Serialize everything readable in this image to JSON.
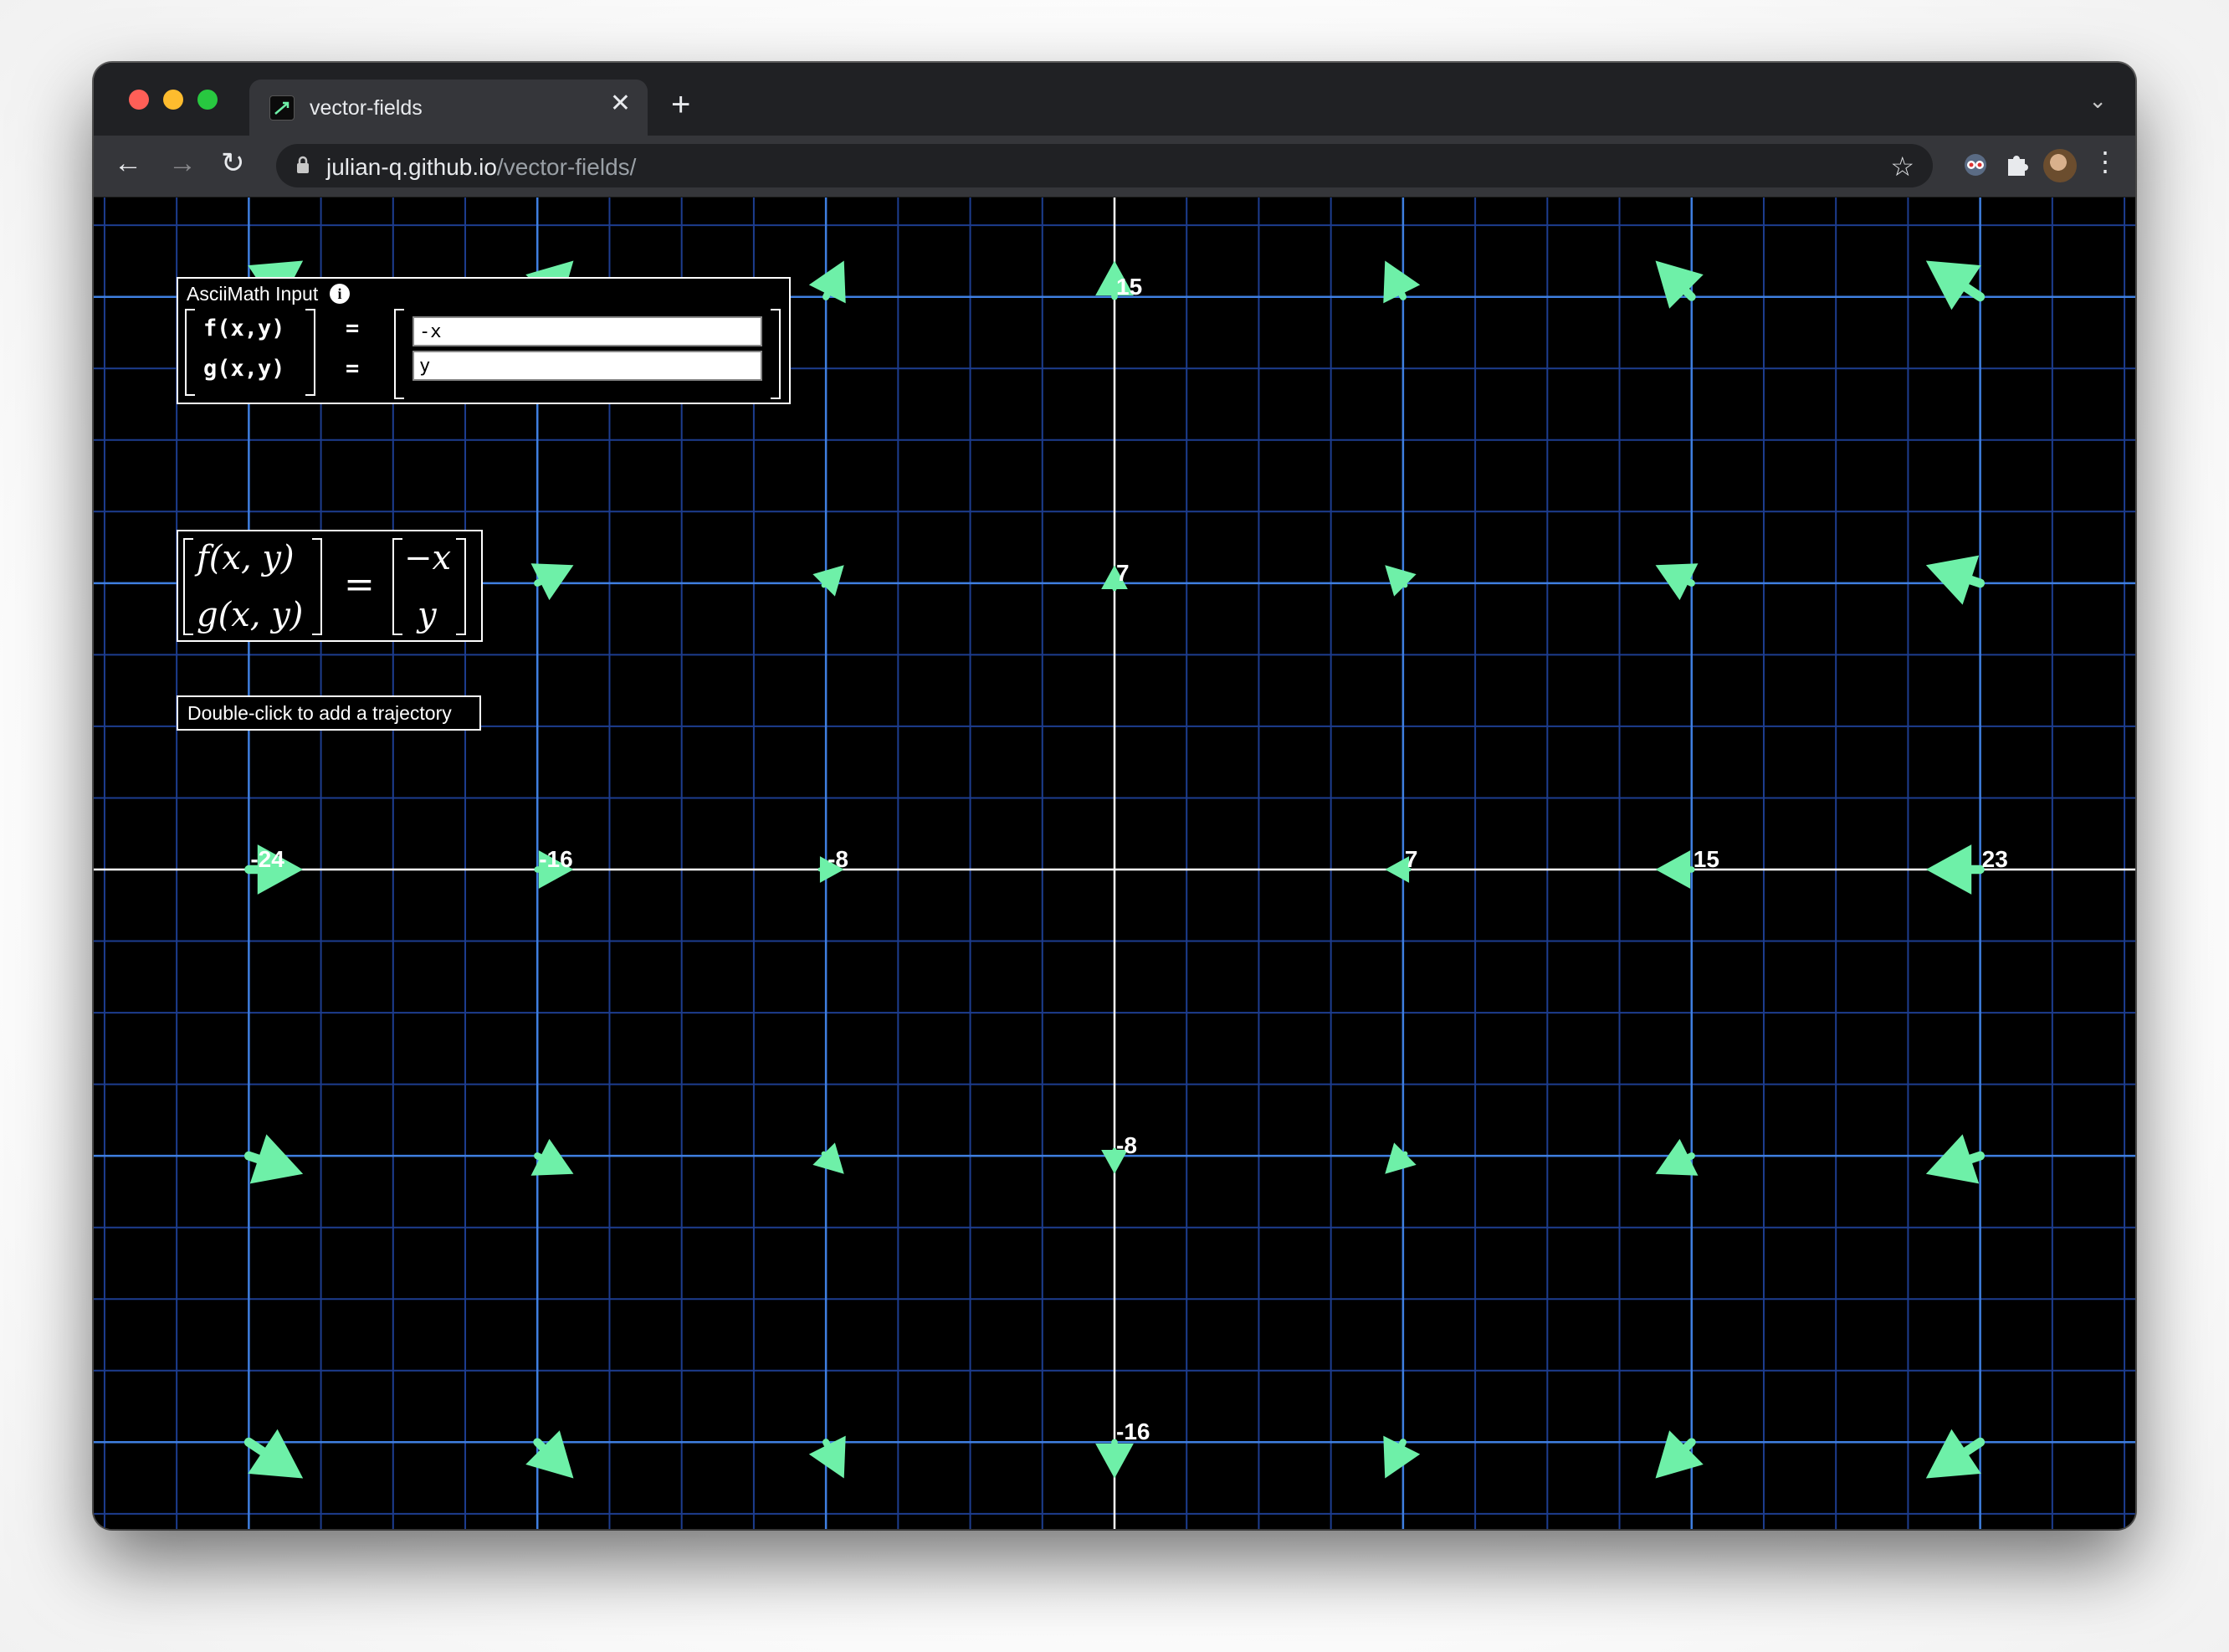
{
  "browser": {
    "tab_title": "vector-fields",
    "url_host": "julian-q.github.io",
    "url_path": "/vector-fields/",
    "tab_close_glyph": "✕",
    "new_tab_glyph": "+"
  },
  "editor": {
    "title": "AsciiMath Input",
    "info_glyph": "i",
    "f_label": "f(x,y)",
    "g_label": "g(x,y)",
    "equals": "=",
    "f_value": "-x",
    "g_value": "y"
  },
  "rendered": {
    "f_label": "f(x, y)",
    "g_label": "g(x, y)",
    "equals": "=",
    "f_expr": "−x",
    "g_expr": "y"
  },
  "hint": "Double-click to add a trajectory",
  "colors": {
    "background": "#000000",
    "grid_minor": "#1d3d8f",
    "grid_major": "#3f7fe0",
    "axis": "#ffffff",
    "arrow": "#6ef0a8"
  },
  "icons": [
    "back-arrow-icon",
    "forward-arrow-icon",
    "reload-icon",
    "lock-icon",
    "star-icon",
    "extension-mascot-icon",
    "puzzle-icon",
    "avatar",
    "kebab-menu-icon",
    "info-icon",
    "chevron-down-icon"
  ],
  "chart_data": {
    "type": "vector_field",
    "field": {
      "f": "-x",
      "g": "y"
    },
    "x_ticks": [
      "-24",
      "-16",
      "-8",
      "7",
      "15",
      "23"
    ],
    "y_ticks": [
      "15",
      "7",
      "-8",
      "-16"
    ],
    "x_axis_tick_values": [
      -24,
      -16,
      -8,
      7,
      15,
      23
    ],
    "y_axis_tick_values": [
      15,
      7,
      -8,
      -16
    ],
    "sample_x": [
      -24,
      -16,
      -8,
      0,
      8,
      16,
      24
    ],
    "sample_y": [
      16,
      8,
      0,
      -8,
      -16
    ],
    "xlim": [
      -28.3,
      28.3
    ],
    "ylim": [
      -18.6,
      18.6
    ],
    "grid": true
  }
}
